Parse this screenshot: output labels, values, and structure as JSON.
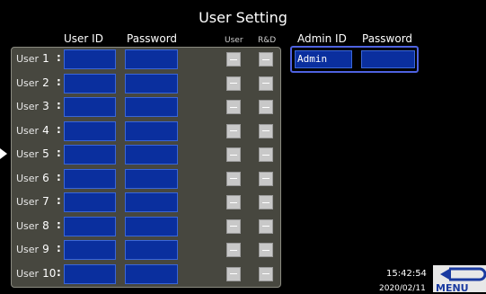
{
  "title": "User Setting",
  "headers": {
    "user_id": "User ID",
    "password": "Password",
    "user": "User",
    "rd": "R&D",
    "admin_id": "Admin ID",
    "admin_password": "Password"
  },
  "users": [
    {
      "label": "User",
      "num": "1"
    },
    {
      "label": "User",
      "num": "2"
    },
    {
      "label": "User",
      "num": "3"
    },
    {
      "label": "User",
      "num": "4"
    },
    {
      "label": "User",
      "num": "5"
    },
    {
      "label": "User",
      "num": "6"
    },
    {
      "label": "User",
      "num": "7"
    },
    {
      "label": "User",
      "num": "8"
    },
    {
      "label": "User",
      "num": "9"
    },
    {
      "label": "User",
      "num": "10"
    }
  ],
  "colon": ":",
  "admin": {
    "id_value": "Admin"
  },
  "status": {
    "time": "15:42:54",
    "date": "2020/02/11"
  },
  "menu": {
    "label": "MENU"
  },
  "colors": {
    "field": "#0a2f9e",
    "panel": "#47473f",
    "admin_border": "#4e62e0"
  }
}
